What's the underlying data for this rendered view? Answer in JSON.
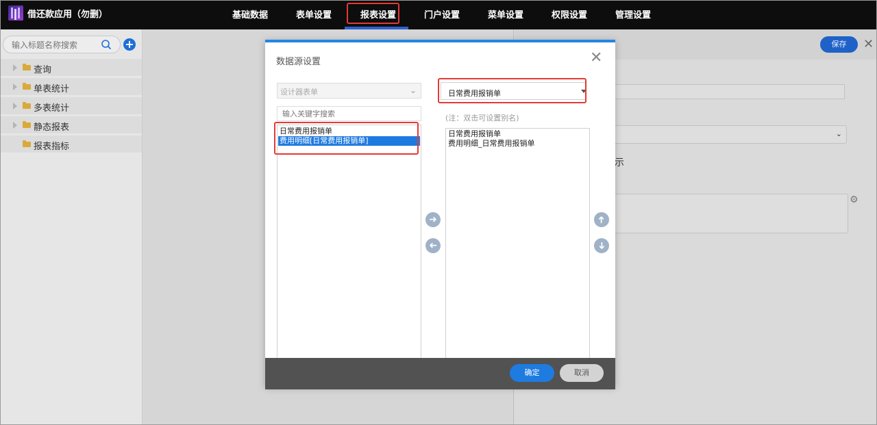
{
  "app": {
    "title": "借还款应用（勿删）"
  },
  "nav": {
    "items": [
      {
        "label": "基础数据"
      },
      {
        "label": "表单设置"
      },
      {
        "label": "报表设置"
      },
      {
        "label": "门户设置"
      },
      {
        "label": "菜单设置"
      },
      {
        "label": "权限设置"
      },
      {
        "label": "管理设置"
      }
    ],
    "active": "报表设置"
  },
  "sidebar": {
    "search_placeholder": "输入标题名称搜索",
    "items": [
      {
        "label": "查询",
        "expandable": true
      },
      {
        "label": "单表统计",
        "expandable": true
      },
      {
        "label": "多表统计",
        "expandable": true
      },
      {
        "label": "静态报表",
        "expandable": true
      },
      {
        "label": "报表指标",
        "expandable": false
      }
    ]
  },
  "right_panel": {
    "save_label": "保存",
    "partial_text": "示"
  },
  "modal": {
    "title": "数据源设置",
    "left": {
      "select_value": "设计器表单",
      "keyword_placeholder": "输入关键字搜索",
      "items": [
        {
          "label": "日常费用报销单",
          "selected": false
        },
        {
          "label": "费用明细[日常费用报销单]",
          "selected": true
        }
      ]
    },
    "right": {
      "select_value": "日常费用报销单",
      "note": "(注：双击可设置别名)",
      "items": [
        {
          "label": "日常费用报销单"
        },
        {
          "label": "费用明细_日常费用报销单"
        }
      ]
    },
    "ok_label": "确定",
    "cancel_label": "取消"
  },
  "colors": {
    "accent": "#2186e6",
    "highlight_box": "#e53935",
    "selected_row": "#1f7ae0"
  }
}
